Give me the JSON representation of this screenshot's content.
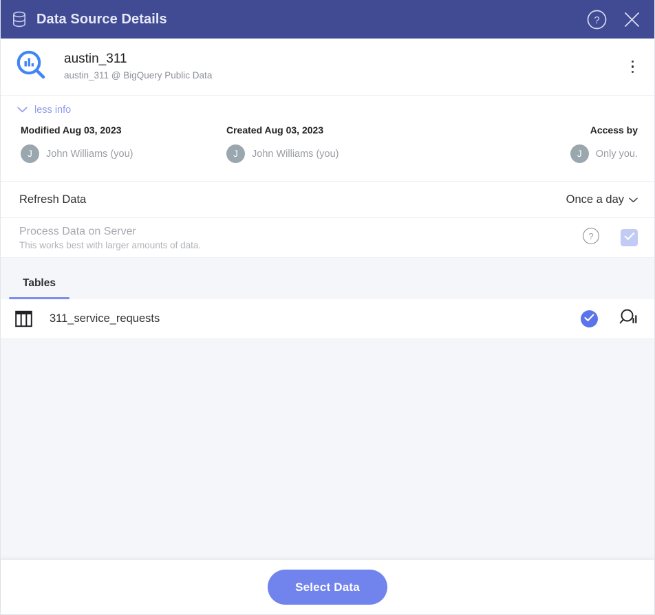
{
  "titlebar": {
    "title": "Data Source Details",
    "db_icon": "database-icon",
    "help_icon": "help-circle-icon",
    "close_icon": "close-icon"
  },
  "source": {
    "logo_icon": "bigquery-logo-icon",
    "name": "austin_311",
    "subtitle": "austin_311 @ BigQuery Public Data",
    "menu_icon": "more-vertical-icon"
  },
  "info_toggle": {
    "label": "less info",
    "icon": "chevron-down-icon"
  },
  "meta": [
    {
      "label": "Modified Aug 03, 2023",
      "avatar_initial": "J",
      "person": "John Williams (you)",
      "align": "left"
    },
    {
      "label": "Created Aug 03, 2023",
      "avatar_initial": "J",
      "person": "John Williams (you)",
      "align": "left"
    },
    {
      "label": "Access by",
      "avatar_initial": "J",
      "person": "Only you.",
      "align": "right"
    }
  ],
  "refresh": {
    "label": "Refresh Data",
    "selected_option": "Once a day",
    "chevron_icon": "chevron-down-icon",
    "options": [
      "Once a day"
    ]
  },
  "process": {
    "title": "Process Data on Server",
    "subtitle": "This works best with larger amounts of data.",
    "help_icon": "help-circle-icon",
    "checkbox_icon": "check-icon",
    "checked": true,
    "disabled": true
  },
  "tabs": [
    {
      "label": "Tables",
      "active": true
    }
  ],
  "tables": [
    {
      "icon": "table-grid-icon",
      "name": "311_service_requests",
      "selected_icon": "check-circle-icon",
      "preview_icon": "explore-data-icon",
      "selected": true
    }
  ],
  "footer": {
    "primary_label": "Select Data"
  },
  "colors": {
    "titlebar_bg": "#414b94",
    "accent": "#7183ec",
    "accent_link": "#8e9bec",
    "selected_check": "#5b74ea",
    "panel_bg": "#f4f6fa",
    "bigquery_blue": "#4285f4",
    "avatar_bg": "#9aa7ae",
    "checkbox_disabled": "#c2cbf3"
  }
}
